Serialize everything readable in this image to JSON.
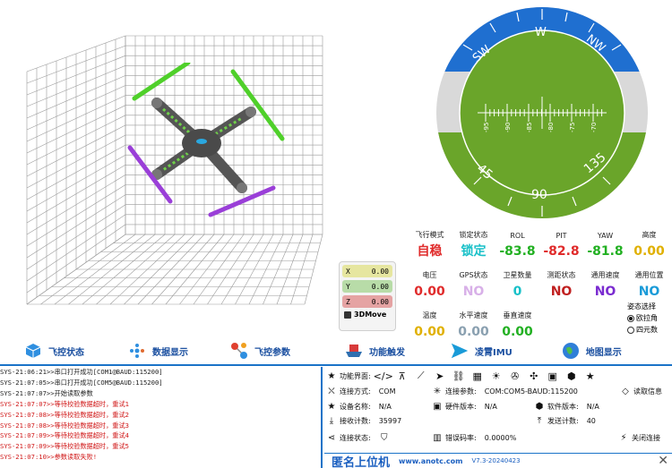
{
  "move_widget": {
    "x_label": "X",
    "x_value": "0.00",
    "y_label": "Y",
    "y_value": "0.00",
    "z_label": "Z",
    "z_value": "0.00",
    "button_label": "3DMove"
  },
  "gauge": {
    "compass": [
      "SW",
      "W",
      "NW"
    ],
    "roll_labels": [
      "45",
      "90",
      "135"
    ],
    "pitch_ticks": [
      "-95",
      "-90",
      "-85",
      "-80",
      "-75",
      "-70"
    ],
    "colors": {
      "sky": "#1f6fd0",
      "ground": "#6aa52a",
      "ring": "#d9d9d9"
    }
  },
  "telemetry": {
    "row1": [
      {
        "label": "飞行模式",
        "value": "自稳",
        "color": "#e02b2b"
      },
      {
        "label": "锁定状态",
        "value": "锁定",
        "color": "#18c0c8"
      },
      {
        "label": "ROL",
        "value": "-83.8",
        "color": "#22b022"
      },
      {
        "label": "PIT",
        "value": "-82.8",
        "color": "#e02b2b"
      },
      {
        "label": "YAW",
        "value": "-81.8",
        "color": "#22b022"
      },
      {
        "label": "高度",
        "value": "0.00",
        "color": "#e0b000"
      }
    ],
    "row2": [
      {
        "label": "电压",
        "value": "0.00",
        "color": "#e02b2b"
      },
      {
        "label": "GPS状态",
        "value": "NO",
        "color": "#d8b0e8"
      },
      {
        "label": "卫星数量",
        "value": "0",
        "color": "#18c0c8"
      },
      {
        "label": "测距状态",
        "value": "NO",
        "color": "#c02020"
      },
      {
        "label": "通用速度",
        "value": "NO",
        "color": "#7a2bd0"
      },
      {
        "label": "通用位置",
        "value": "NO",
        "color": "#1a9bd8"
      }
    ],
    "row3": [
      {
        "label": "温度",
        "value": "0.00",
        "color": "#e0b000"
      },
      {
        "label": "水平速度",
        "value": "0.00",
        "color": "#8aa0b0"
      },
      {
        "label": "垂直速度",
        "value": "0.00",
        "color": "#22b022"
      }
    ],
    "attitude_select": {
      "title": "姿态选择",
      "option1": "欧拉角",
      "option2": "四元数"
    }
  },
  "nav": [
    {
      "label": "飞控状态",
      "icon": "cube-icon"
    },
    {
      "label": "数据显示",
      "icon": "dots-icon"
    },
    {
      "label": "飞控参数",
      "icon": "nodes-icon"
    },
    {
      "label": "功能触发",
      "icon": "ship-icon"
    },
    {
      "label": "凌霄IMU",
      "icon": "arrow-icon"
    },
    {
      "label": "地图显示",
      "icon": "globe-icon"
    }
  ],
  "log": [
    {
      "text": "SYS-21:06:21>>串口打开成功[COM1@BAUD:115200]",
      "type": "ok"
    },
    {
      "text": "SYS-21:07:05>>串口打开成功[COM5@BAUD:115200]",
      "type": "ok"
    },
    {
      "text": "SYS-21:07:07>>开始读取参数",
      "type": "ok"
    },
    {
      "text": "SYS-21:07:07>>等待校验数据超时，重试1",
      "type": "warn"
    },
    {
      "text": "SYS-21:07:08>>等待校验数据超时，重试2",
      "type": "warn"
    },
    {
      "text": "SYS-21:07:08>>等待校验数据超时，重试3",
      "type": "warn"
    },
    {
      "text": "SYS-21:07:09>>等待校验数据超时，重试4",
      "type": "warn"
    },
    {
      "text": "SYS-21:07:09>>等待校验数据超时，重试5",
      "type": "warn"
    },
    {
      "text": "SYS-21:07:10>>参数读取失败!",
      "type": "warn"
    }
  ],
  "info": {
    "func_label": "功能界面:",
    "conn_mode_label": "连接方式:",
    "conn_mode_value": "COM",
    "conn_param_label": "连接参数:",
    "conn_param_value": "COM:COM5-BAUD:115200",
    "read_info": "读取信息",
    "device_label": "设备名称:",
    "device_value": "N/A",
    "hw_label": "硬件版本:",
    "hw_value": "N/A",
    "sw_label": "软件版本:",
    "sw_value": "N/A",
    "rx_label": "接收计数:",
    "rx_value": "35997",
    "tx_label": "发送计数:",
    "tx_value": "40",
    "conn_state_label": "连接状态:",
    "err_label": "错误码率:",
    "err_value": "0.0000%",
    "close_conn": "关闭连接",
    "brand": "匿名上位机",
    "url": "www.anotc.com",
    "version": "V7.3-20240423"
  }
}
